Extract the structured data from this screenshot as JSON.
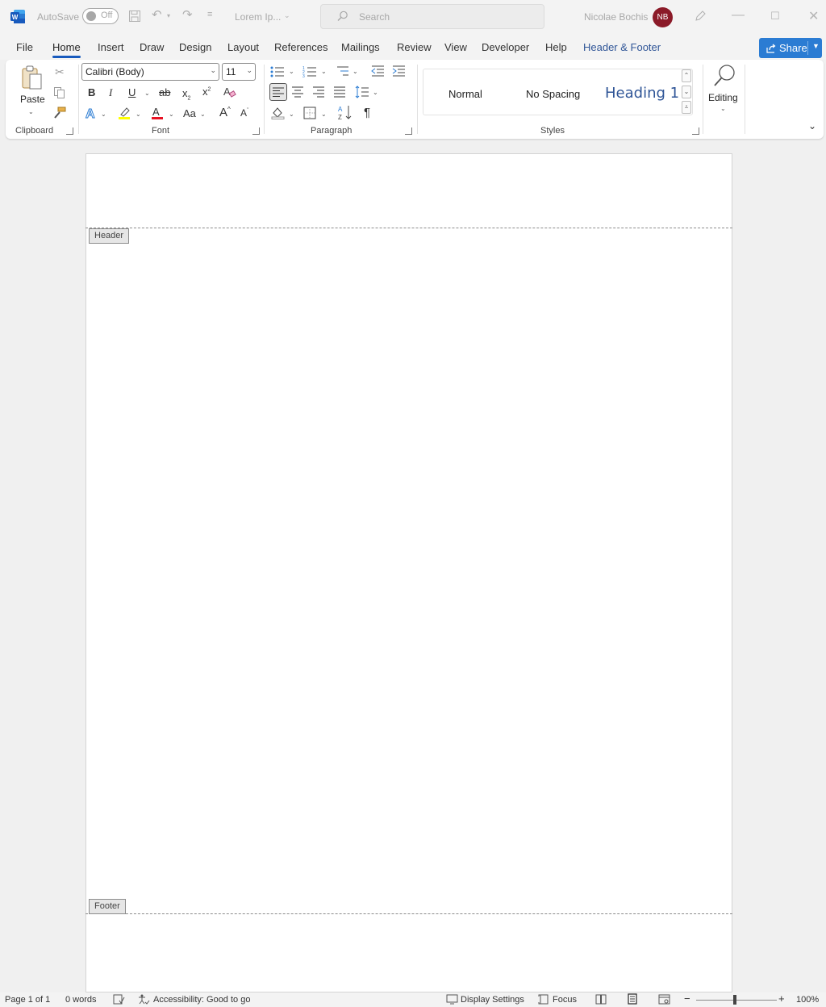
{
  "titlebar": {
    "autosave_label": "AutoSave",
    "autosave_state": "Off",
    "doc_title": "Lorem Ip...",
    "search_placeholder": "Search",
    "user_name": "Nicolae Bochis",
    "user_initials": "NB",
    "logo_letter": "W"
  },
  "menu": {
    "tabs": [
      "File",
      "Home",
      "Insert",
      "Draw",
      "Design",
      "Layout",
      "References",
      "Mailings",
      "Review",
      "View",
      "Developer",
      "Help",
      "Header & Footer"
    ],
    "active_tab": "Home",
    "share_label": "Share"
  },
  "ribbon": {
    "clipboard": {
      "paste_label": "Paste",
      "group_label": "Clipboard"
    },
    "font": {
      "font_name": "Calibri (Body)",
      "font_size": "11",
      "bold": "B",
      "italic": "I",
      "underline": "U",
      "strike": "ab",
      "case_label": "Aa",
      "grow": "A",
      "shrink": "A",
      "group_label": "Font"
    },
    "paragraph": {
      "group_label": "Paragraph",
      "pilcrow": "¶"
    },
    "styles": {
      "items": [
        "Normal",
        "No Spacing",
        "Heading 1"
      ],
      "group_label": "Styles"
    },
    "editing": {
      "label": "Editing"
    }
  },
  "document": {
    "header_tag": "Header",
    "footer_tag": "Footer"
  },
  "statusbar": {
    "page": "Page 1 of 1",
    "words": "0 words",
    "accessibility": "Accessibility: Good to go",
    "display_settings": "Display Settings",
    "focus": "Focus",
    "zoom": "100%",
    "zoom_level": 1.0
  },
  "colors": {
    "accent": "#185abd",
    "share_bg": "#2b7cd3",
    "avatar_bg": "#8b1a28",
    "header_footer_tab": "#2f5597",
    "highlight_yellow": "#ffff00",
    "font_color_red": "#e81123"
  }
}
